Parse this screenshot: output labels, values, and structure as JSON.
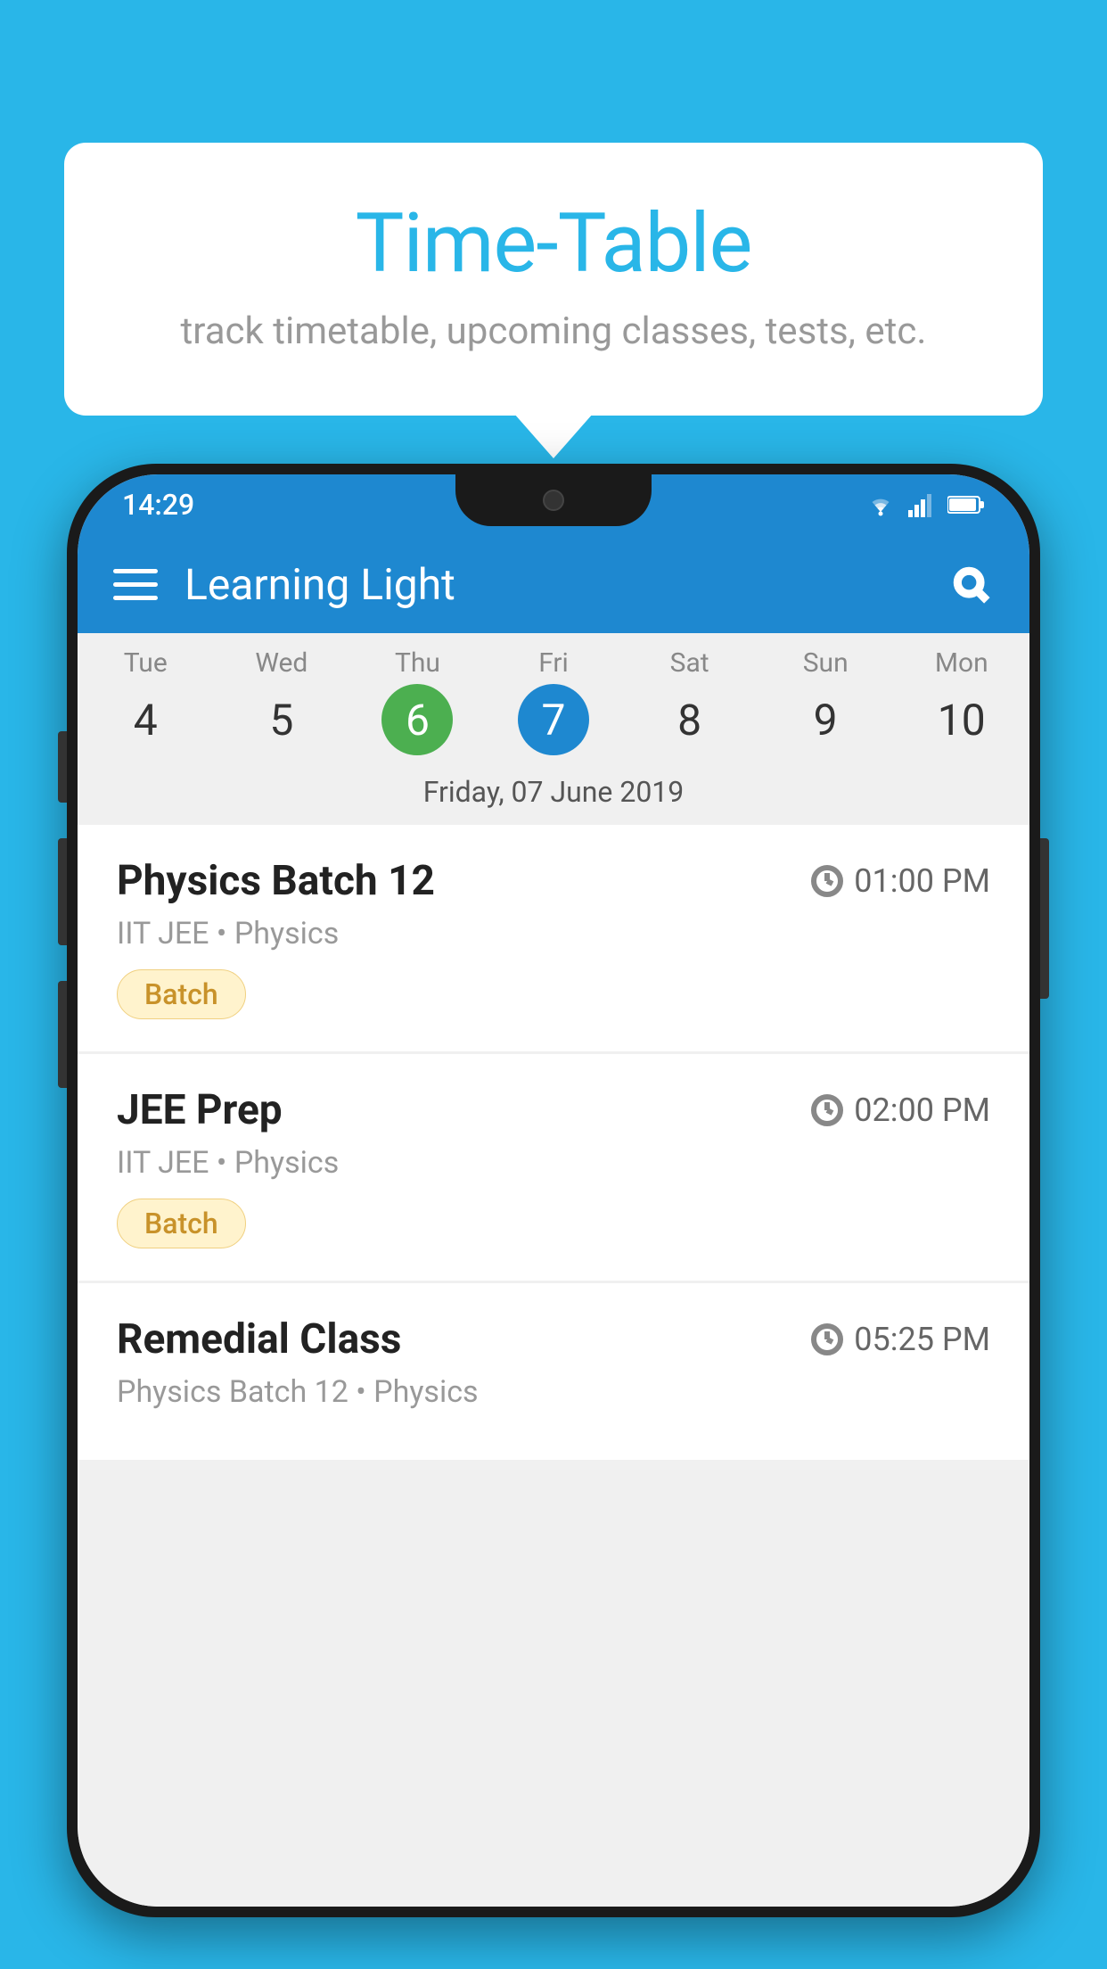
{
  "background_color": "#29b6e8",
  "tooltip": {
    "title": "Time-Table",
    "subtitle": "track timetable, upcoming classes, tests, etc."
  },
  "phone": {
    "status_bar": {
      "time": "14:29"
    },
    "toolbar": {
      "app_name": "Learning Light",
      "hamburger_icon": "hamburger-icon",
      "search_icon": "search-icon"
    },
    "calendar": {
      "days": [
        {
          "name": "Tue",
          "number": "4",
          "state": "normal"
        },
        {
          "name": "Wed",
          "number": "5",
          "state": "normal"
        },
        {
          "name": "Thu",
          "number": "6",
          "state": "today"
        },
        {
          "name": "Fri",
          "number": "7",
          "state": "selected"
        },
        {
          "name": "Sat",
          "number": "8",
          "state": "normal"
        },
        {
          "name": "Sun",
          "number": "9",
          "state": "normal"
        },
        {
          "name": "Mon",
          "number": "10",
          "state": "normal"
        }
      ],
      "selected_date_label": "Friday, 07 June 2019"
    },
    "schedule_items": [
      {
        "title": "Physics Batch 12",
        "time": "01:00 PM",
        "meta": "IIT JEE • Physics",
        "badge": "Batch"
      },
      {
        "title": "JEE Prep",
        "time": "02:00 PM",
        "meta": "IIT JEE • Physics",
        "badge": "Batch"
      },
      {
        "title": "Remedial Class",
        "time": "05:25 PM",
        "meta": "Physics Batch 12 • Physics",
        "badge": null
      }
    ]
  }
}
